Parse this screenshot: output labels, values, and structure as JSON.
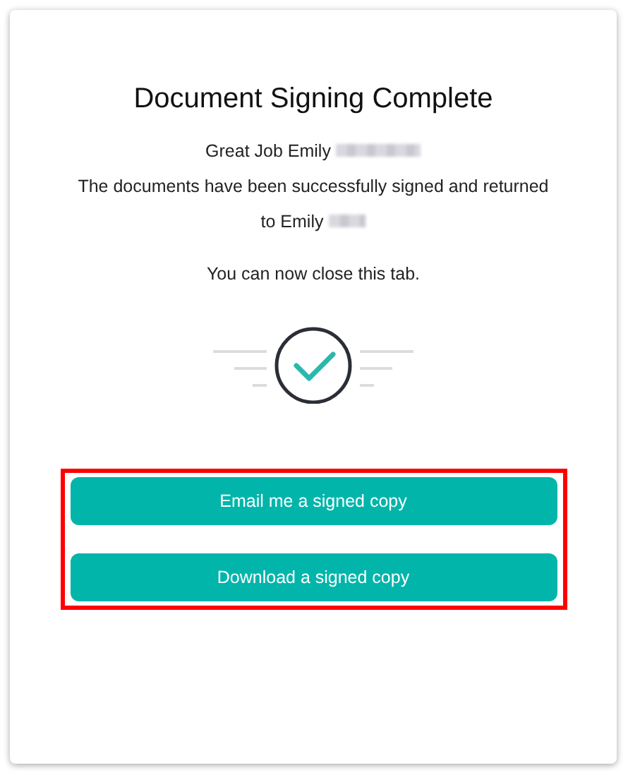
{
  "title": "Document Signing Complete",
  "messages": [
    {
      "text": "Great Job Emily",
      "redacted": true
    },
    {
      "text": "The documents have been successfully signed and returned",
      "redacted": false
    },
    {
      "text": "to Emily",
      "redacted": true
    }
  ],
  "closing_note": "You can now close this tab.",
  "actions": {
    "highlighted": true,
    "buttons": [
      "Email me a signed copy",
      "Download a signed copy"
    ]
  }
}
